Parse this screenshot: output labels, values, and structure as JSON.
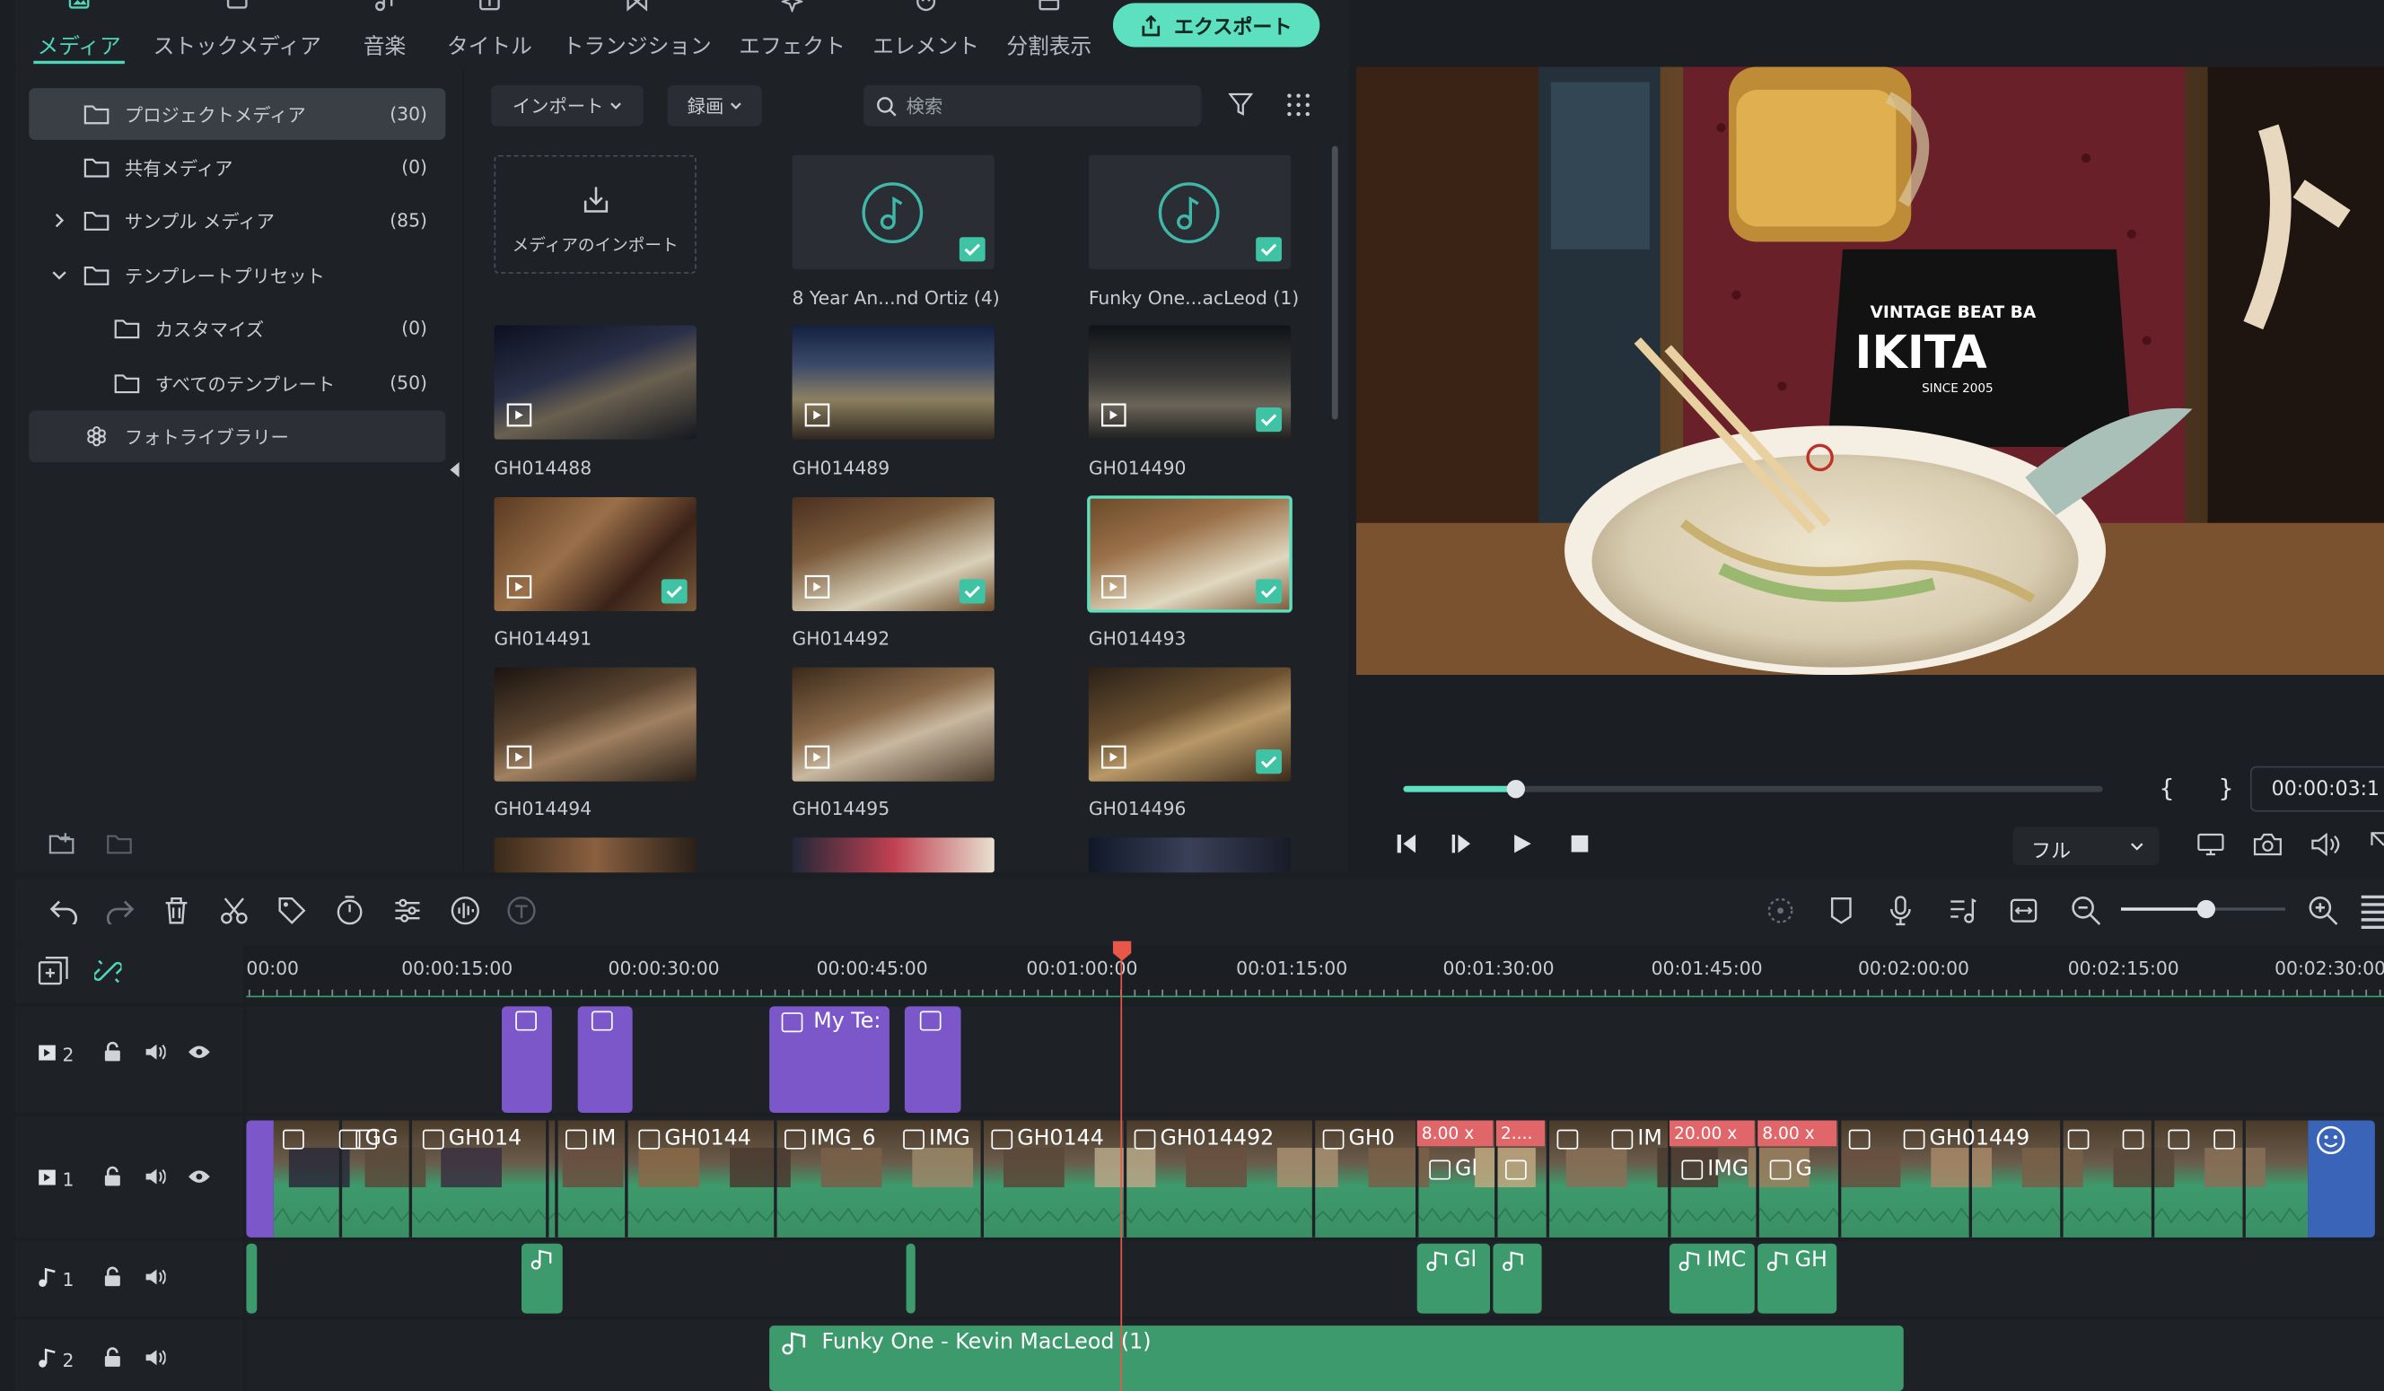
{
  "tabs": [
    {
      "label": "メディア",
      "icon": "media-icon",
      "active": true
    },
    {
      "label": "ストックメディア",
      "icon": "stock-media-icon"
    },
    {
      "label": "音楽",
      "icon": "music-icon"
    },
    {
      "label": "タイトル",
      "icon": "title-icon"
    },
    {
      "label": "トランジション",
      "icon": "transition-icon"
    },
    {
      "label": "エフェクト",
      "icon": "effect-icon"
    },
    {
      "label": "エレメント",
      "icon": "element-icon"
    },
    {
      "label": "分割表示",
      "icon": "split-icon"
    }
  ],
  "export_label": "エクスポート",
  "library": [
    {
      "label": "プロジェクトメディア",
      "count": "(30)",
      "selected": true
    },
    {
      "label": "共有メディア",
      "count": "(0)"
    },
    {
      "label": "サンプル メディア",
      "count": "(85)",
      "chevron": "right"
    },
    {
      "label": "テンプレートプリセット",
      "count": "",
      "chevron": "down"
    },
    {
      "label": "カスタマイズ",
      "count": "(0)"
    },
    {
      "label": "すべてのテンプレート",
      "count": "(50)"
    },
    {
      "label": "フォトライブラリー",
      "count": ""
    }
  ],
  "toolbar": {
    "import": "インポート",
    "record": "録画",
    "search_placeholder": "検索"
  },
  "media_items": [
    {
      "name": "メディアのインポート",
      "kind": "import"
    },
    {
      "name": "8 Year An...nd Ortiz (4)",
      "kind": "audio",
      "checked": true
    },
    {
      "name": "Funky One...acLeod (1)",
      "kind": "audio",
      "checked": true
    },
    {
      "name": "GH014488",
      "kind": "video",
      "checked": false
    },
    {
      "name": "GH014489",
      "kind": "video",
      "checked": false
    },
    {
      "name": "GH014490",
      "kind": "video",
      "checked": true
    },
    {
      "name": "GH014491",
      "kind": "video",
      "checked": true
    },
    {
      "name": "GH014492",
      "kind": "video",
      "checked": true
    },
    {
      "name": "GH014493",
      "kind": "video",
      "checked": true,
      "highlighted": true
    },
    {
      "name": "GH014494",
      "kind": "video",
      "checked": false
    },
    {
      "name": "GH014495",
      "kind": "video",
      "checked": false
    },
    {
      "name": "GH014496",
      "kind": "video",
      "checked": true
    }
  ],
  "player": {
    "timecode": "00:00:03:1",
    "quality": "フル",
    "progress": 0.16,
    "mark_in": "{",
    "mark_out": "}"
  },
  "ruler": [
    "00:00",
    "00:00:15:00",
    "00:00:30:00",
    "00:00:45:00",
    "00:01:00:00",
    "00:01:15:00",
    "00:01:30:00",
    "00:01:45:00",
    "00:02:00:00",
    "00:02:15:00",
    "00:02:30:00"
  ],
  "tracks": {
    "v2": "2",
    "v1": "1",
    "a1": "1",
    "a2": "2"
  },
  "v2_clips": [
    "",
    "",
    "My Te:",
    ""
  ],
  "v1_clips": [
    "G",
    "G",
    "GH014",
    "IM",
    "GH0144",
    "IMG_6",
    "IMG",
    "GH0144",
    "GH014492",
    "GH0",
    "Gl",
    "IM",
    "IMG",
    "G",
    "GH01449"
  ],
  "speeds": [
    "8.00 x",
    "2....",
    "20.00 x",
    "8.00 x"
  ],
  "a1_clips": [
    "Gl",
    "IMC",
    "GH"
  ],
  "a2_clip": "Funky One - Kevin MacLeod (1)",
  "colors": {
    "accent": "#5ce0c0",
    "title_clip": "#7b57c9",
    "video_clip": "#3d9a6c",
    "playhead": "#e8584a"
  }
}
